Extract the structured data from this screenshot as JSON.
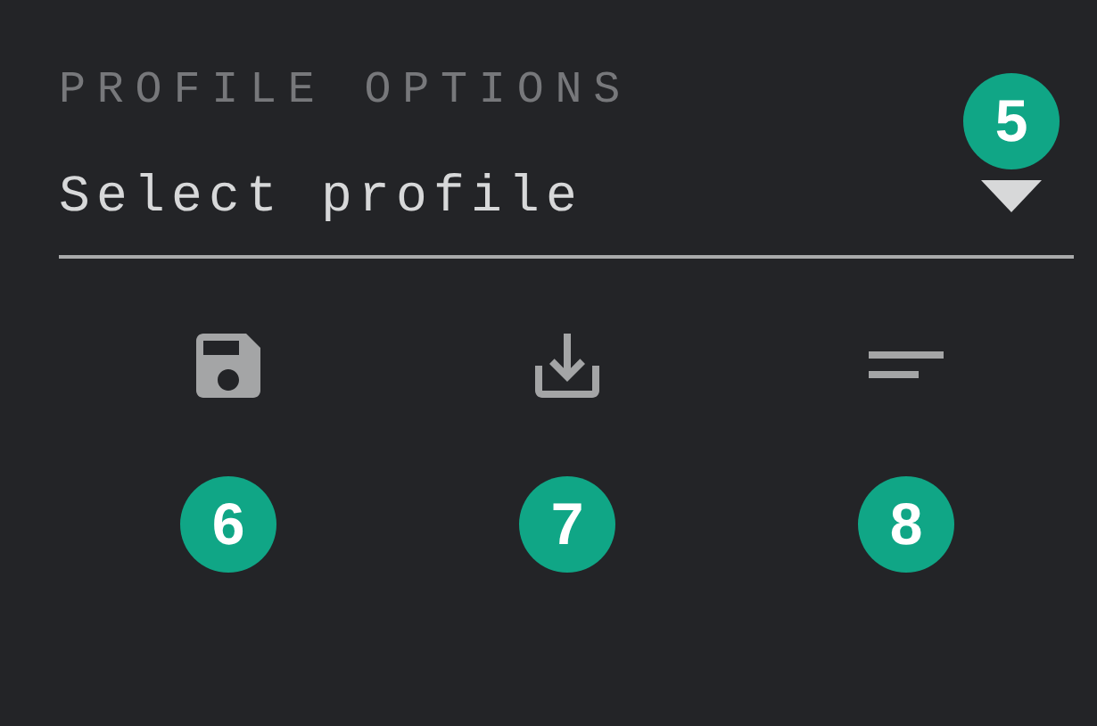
{
  "section_title": "PROFILE OPTIONS",
  "section_badge": "5",
  "profile_select": {
    "placeholder": "Select profile"
  },
  "actions": [
    {
      "kind": "save",
      "badge": "6"
    },
    {
      "kind": "download",
      "badge": "7"
    },
    {
      "kind": "sort",
      "badge": "8"
    }
  ]
}
